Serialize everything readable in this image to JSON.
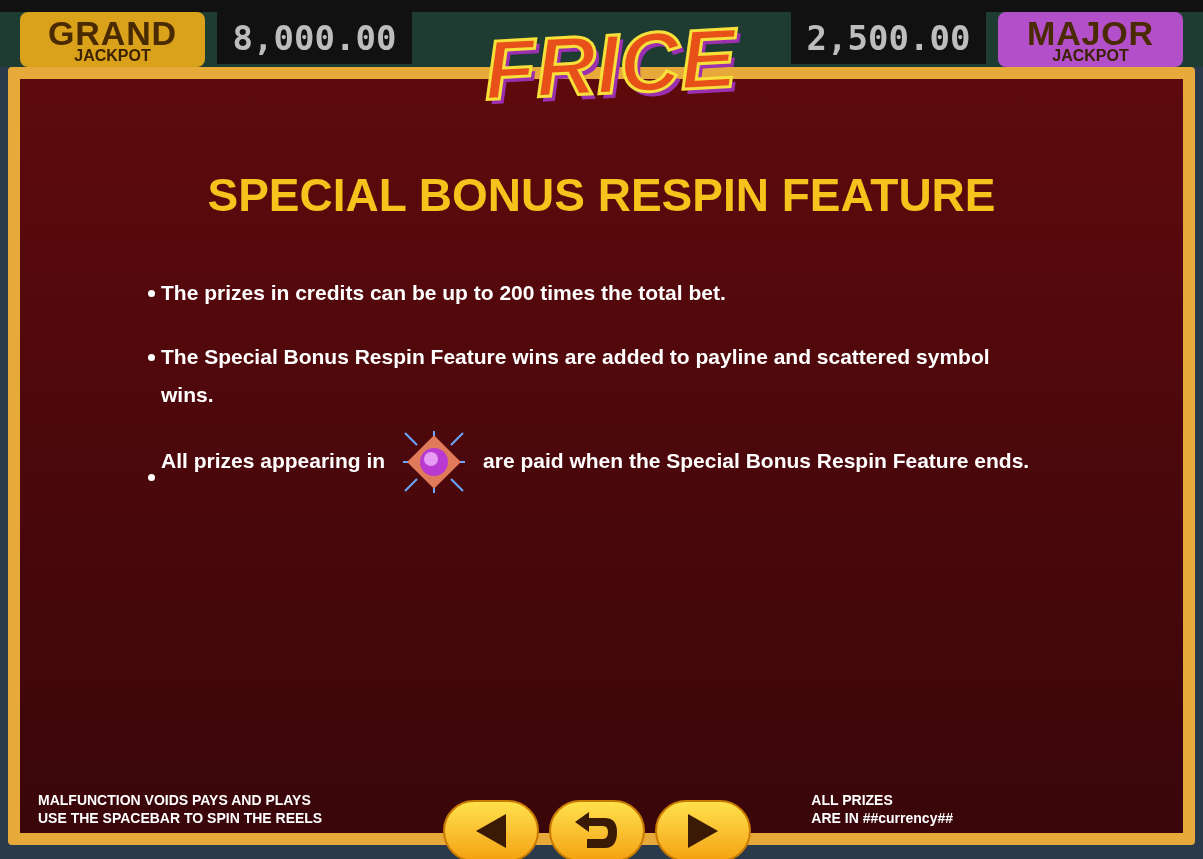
{
  "jackpots": [
    {
      "logo_top": "GRAND",
      "logo_bottom": "JACKPOT",
      "value": "8,000.00",
      "color": "#d9a21a"
    },
    {
      "logo_top": "MAJOR",
      "logo_bottom": "JACKPOT",
      "value": "2,500.00",
      "color": "#b24fc9"
    }
  ],
  "logo": "FRICE",
  "panel": {
    "title": "SPECIAL BONUS RESPIN FEATURE",
    "bullets": [
      {
        "kind": "text",
        "text": "The prizes in credits can be up to 200 times the total bet."
      },
      {
        "kind": "text",
        "text": "The Special Bonus Respin Feature wins are added to payline and scattered symbol wins."
      },
      {
        "kind": "icon",
        "before": "All prizes appearing in",
        "after": "are paid when the Special Bonus Respin Feature ends."
      }
    ]
  },
  "footer": {
    "left": [
      "MALFUNCTION VOIDS PAYS AND PLAYS",
      "USE THE SPACEBAR TO SPIN THE REELS"
    ],
    "right": [
      "ALL PRIZES",
      "ARE IN ##currency##"
    ]
  },
  "nav": [
    {
      "kind": "prev"
    },
    {
      "kind": "back"
    },
    {
      "kind": "next"
    }
  ]
}
